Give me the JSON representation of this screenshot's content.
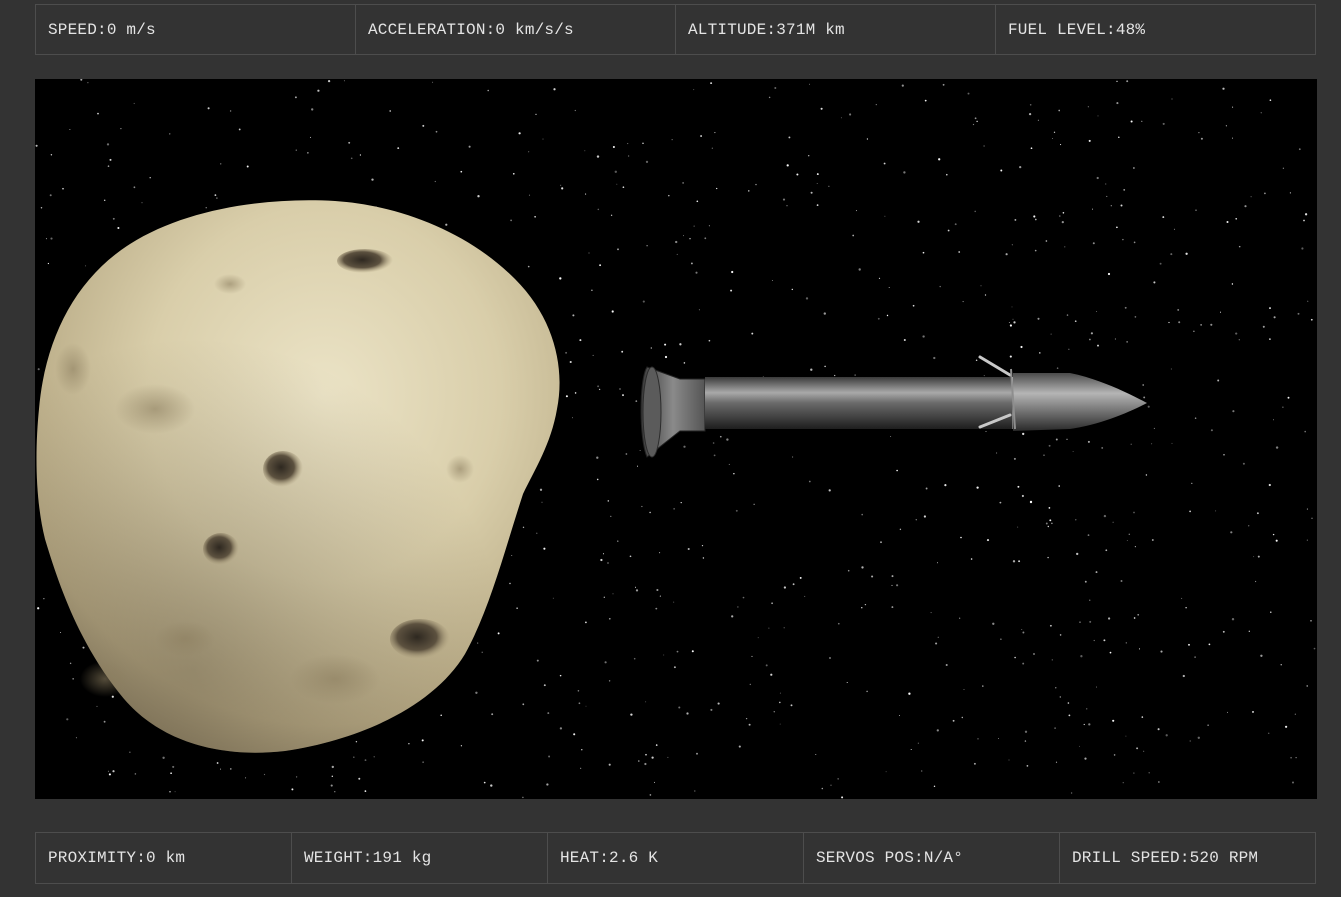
{
  "telemetry_top": [
    {
      "label": "SPEED:",
      "value": "0 m/s"
    },
    {
      "label": "ACCELERATION:",
      "value": "0 km/s/s"
    },
    {
      "label": "ALTITUDE:",
      "value": "371M km"
    },
    {
      "label": "FUEL LEVEL:",
      "value": "48%"
    }
  ],
  "telemetry_bottom": [
    {
      "label": "PROXIMITY:",
      "value": "0 km"
    },
    {
      "label": "WEIGHT:",
      "value": "191 kg"
    },
    {
      "label": "HEAT:",
      "value": "2.6 K"
    },
    {
      "label": "SERVOS POS:",
      "value": "N/A°"
    },
    {
      "label": "DRILL SPEED:",
      "value": "520 RPM"
    }
  ],
  "scene": {
    "background_color": "#000000",
    "asteroid_color": "#d9cfae",
    "rocket_color": "#5a5a5a",
    "objects": [
      "asteroid-icon",
      "rocket-icon",
      "starfield"
    ]
  }
}
